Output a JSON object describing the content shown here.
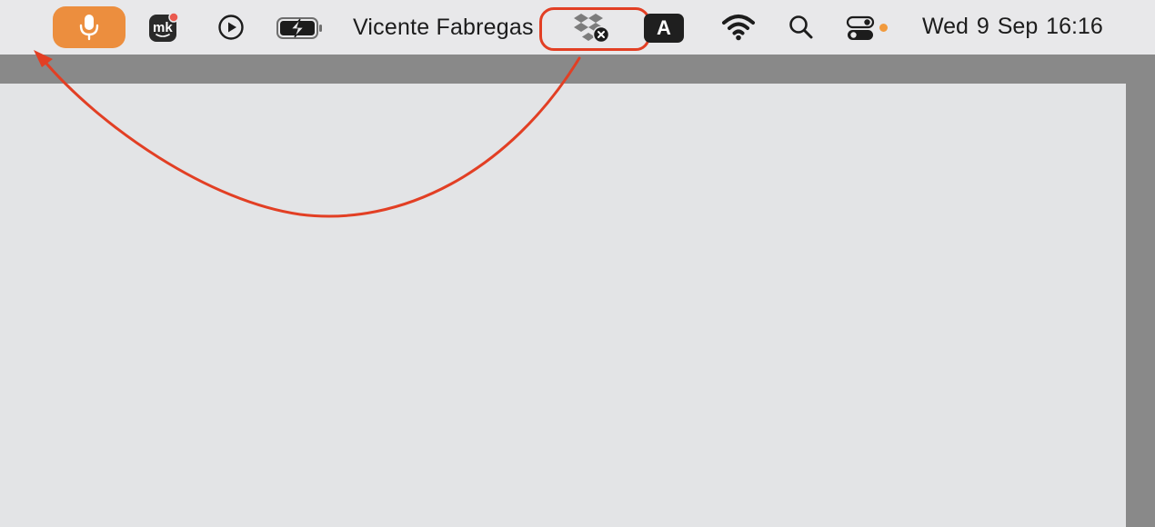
{
  "menubar": {
    "user_name": "Vicente Fabregas",
    "input_source": "A",
    "clock": "Wed 9 Sep  16:16",
    "icons": {
      "microphone": "microphone-icon",
      "mk": "mk-app-icon",
      "play": "play-icon",
      "battery": "battery-charging-icon",
      "dropbox": "dropbox-icon",
      "input_source": "input-source-icon",
      "wifi": "wifi-icon",
      "search": "search-icon",
      "control_center": "control-center-icon"
    }
  },
  "colors": {
    "mic_accent": "#ec8e3e",
    "annotation": "#e23f24",
    "menubar_bg": "#e8e8ea",
    "overlay_gray": "#898989",
    "window_bg": "#e3e4e6"
  }
}
